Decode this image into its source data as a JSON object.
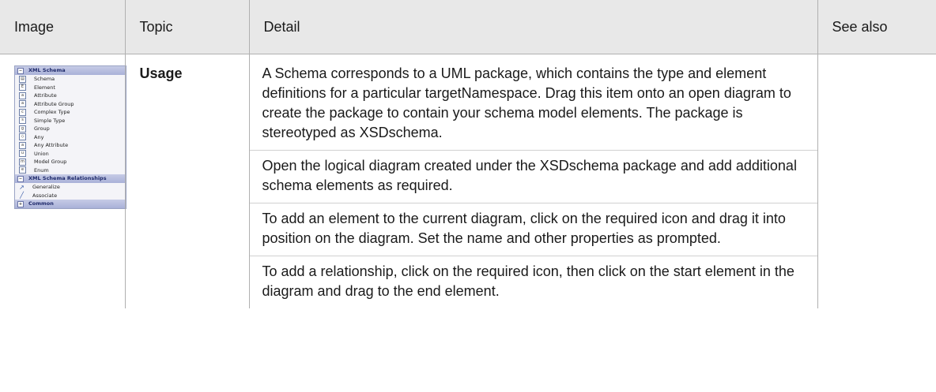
{
  "headers": {
    "image": "Image",
    "topic": "Topic",
    "detail": "Detail",
    "see_also": "See also"
  },
  "row": {
    "topic": "Usage",
    "paragraphs": [
      "A Schema corresponds to a UML package, which contains the type and element definitions for a particular targetNamespace. Drag this item onto an open diagram to create the package to contain your schema model elements. The package is stereotyped as XSDschema.",
      "Open the logical diagram created under the XSDschema package and add additional schema elements as required.",
      "To add an element to the current diagram, click on the required icon and drag it into position on the diagram. Set the name and other properties as prompted.",
      "To add a relationship, click on the required icon, then click on the start element in the diagram and drag to the end element."
    ],
    "see_also": ""
  },
  "toolbox": {
    "section1": {
      "title": "XML Schema",
      "toggle": "−"
    },
    "items1": [
      {
        "label": "Schema",
        "icon": "schema-icon",
        "glyph": "▤"
      },
      {
        "label": "Element",
        "icon": "element-icon",
        "glyph": "E"
      },
      {
        "label": "Attribute",
        "icon": "attribute-icon",
        "glyph": "a"
      },
      {
        "label": "Attribute Group",
        "icon": "attribute-group-icon",
        "glyph": "a"
      },
      {
        "label": "Complex Type",
        "icon": "complex-type-icon",
        "glyph": "c"
      },
      {
        "label": "Simple Type",
        "icon": "simple-type-icon",
        "glyph": "s"
      },
      {
        "label": "Group",
        "icon": "group-icon",
        "glyph": "g"
      },
      {
        "label": "Any",
        "icon": "any-icon",
        "glyph": "◇"
      },
      {
        "label": "Any Attribute",
        "icon": "any-attribute-icon",
        "glyph": "a"
      },
      {
        "label": "Union",
        "icon": "union-icon",
        "glyph": "u"
      },
      {
        "label": "Model Group",
        "icon": "model-group-icon",
        "glyph": "m"
      },
      {
        "label": "Enum",
        "icon": "enum-icon",
        "glyph": "e"
      }
    ],
    "section2": {
      "title": "XML Schema Relationships",
      "toggle": "−"
    },
    "items2": [
      {
        "label": "Generalize",
        "icon": "generalize-arrow-icon",
        "glyph": "↗"
      },
      {
        "label": "Associate",
        "icon": "associate-line-icon",
        "glyph": "╱"
      }
    ],
    "section3": {
      "title": "Common",
      "toggle": "+"
    }
  }
}
